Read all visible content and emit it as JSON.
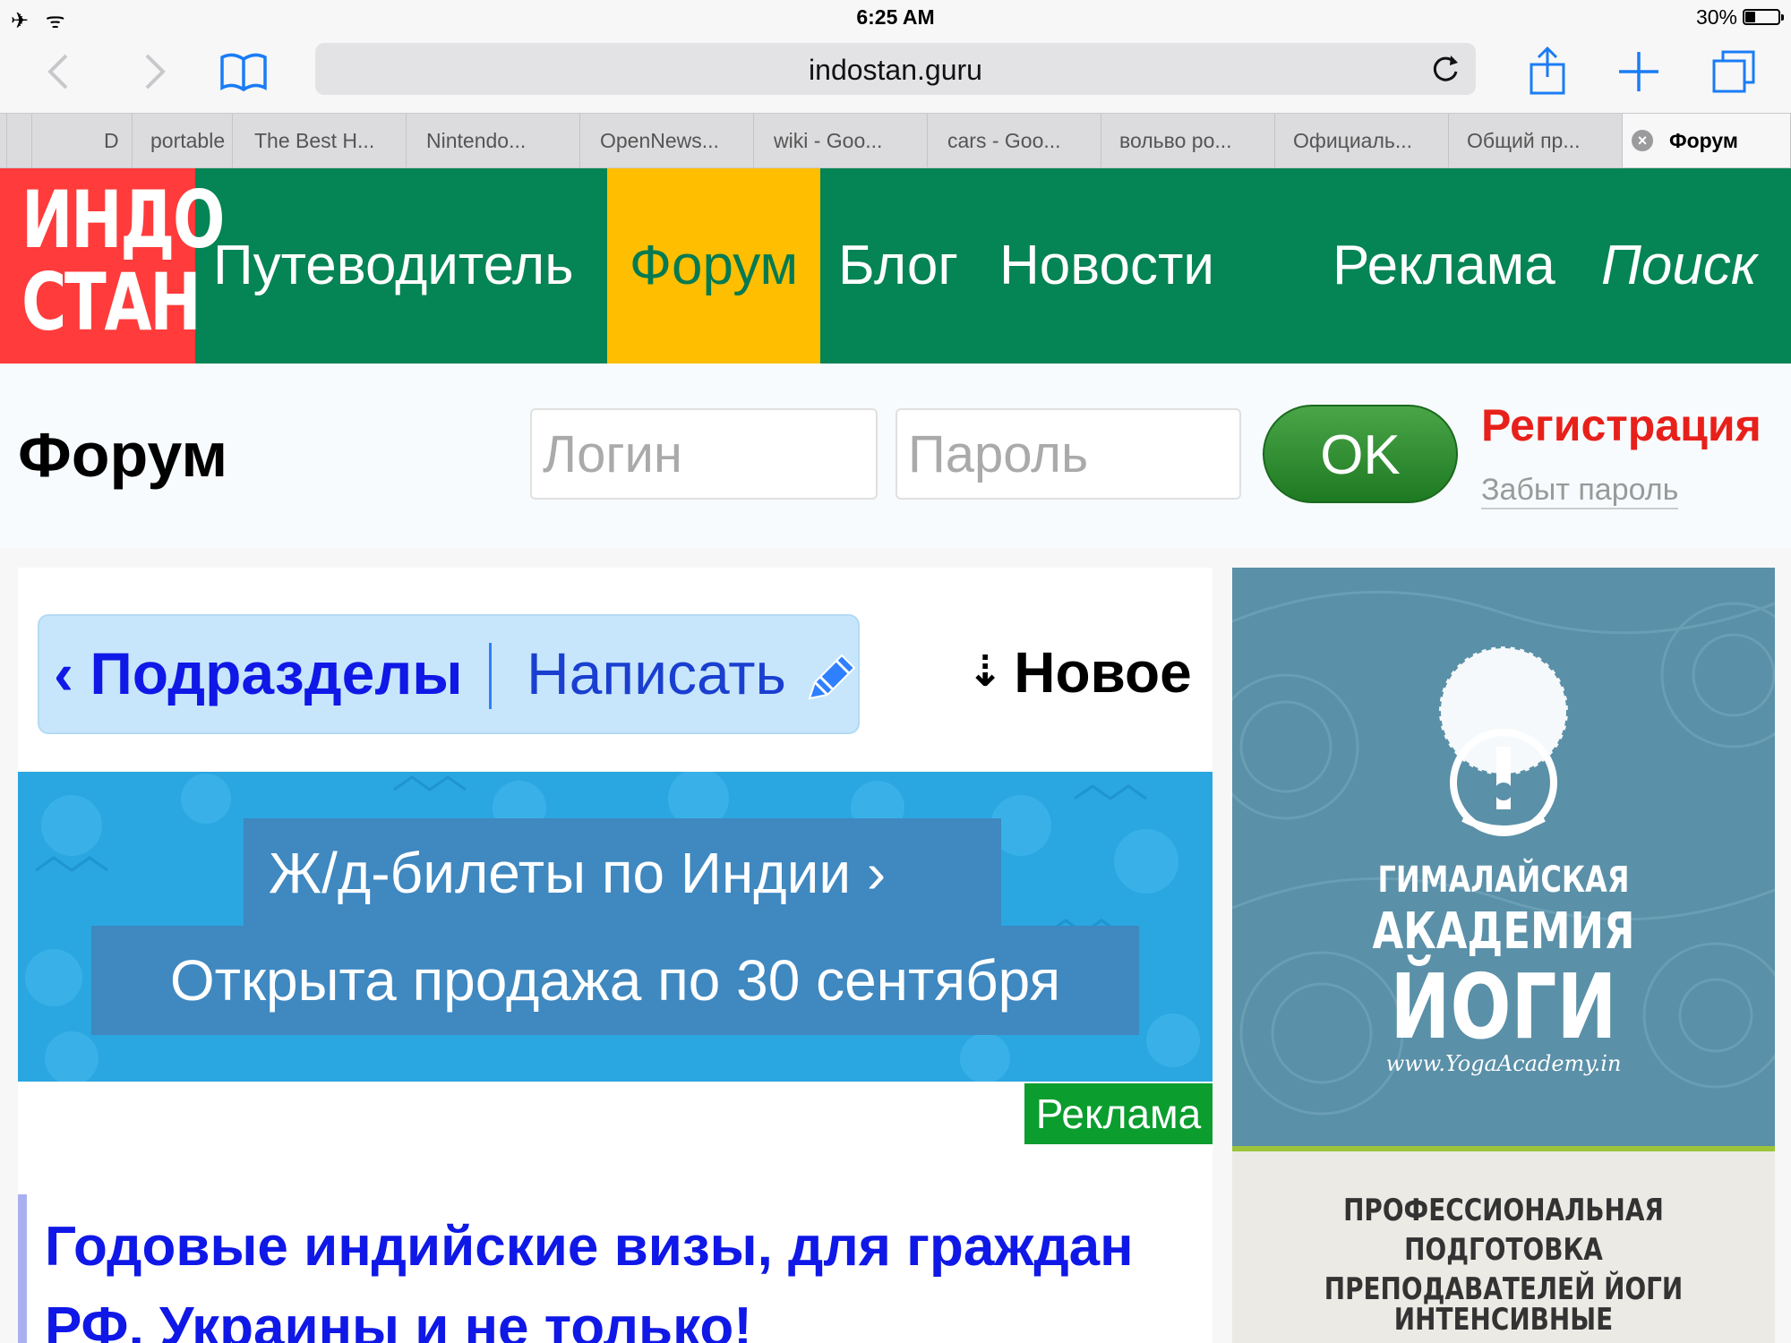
{
  "status_bar": {
    "left_icons": "✈ ᯤ",
    "time": "6:25 AM",
    "battery_text": "30%",
    "battery_level": 0.3
  },
  "toolbar": {
    "url": "indostan.guru",
    "icons": [
      "back-icon",
      "forward-icon",
      "bookmarks-icon",
      "reload-icon",
      "share-icon",
      "new-tab-icon",
      "tabs-icon"
    ]
  },
  "tabs": [
    {
      "label": ""
    },
    {
      "label": ""
    },
    {
      "label": "D"
    },
    {
      "label": "portable"
    },
    {
      "label": "The Best H..."
    },
    {
      "label": "Nintendo..."
    },
    {
      "label": "OpenNews..."
    },
    {
      "label": "wiki - Goo..."
    },
    {
      "label": "cars - Goo..."
    },
    {
      "label": "вольво ро..."
    },
    {
      "label": "Официаль..."
    },
    {
      "label": "Общий пр..."
    },
    {
      "label": "Форум",
      "active": true
    }
  ],
  "site": {
    "logo_line1": "ИНДО",
    "logo_line2": "СТАН",
    "nav": {
      "guide": "Путеводитель",
      "forum": "Форум",
      "blog": "Блог",
      "news": "Новости",
      "ads": "Реклама",
      "search": "Поиск"
    },
    "colors": {
      "nav_bg": "#058455",
      "nav_active": "#ffbe00",
      "logo_bg": "#ff3b3b",
      "link_blue": "#0f18e6",
      "register_red": "#e8201b"
    }
  },
  "login": {
    "page_title": "Форум",
    "login_placeholder": "Логин",
    "password_placeholder": "Пароль",
    "ok_label": "OK",
    "register_label": "Регистрация",
    "forgot_label": "Забыт пароль"
  },
  "forum_toolbar": {
    "subsections_label": "‹ Подразделы",
    "write_label": "Написать",
    "new_label": "Новое"
  },
  "banner": {
    "line1": "Ж/д-билеты по Индии  ›",
    "line2": "Открыта продажа по 30 сентября",
    "ad_label": "Реклама"
  },
  "article": {
    "title": "Годовые индийские визы, для граждан РФ, Украины и не только!"
  },
  "side_ad": {
    "line1": "ГИМАЛАЙСКАЯ",
    "line2": "АКАДЕМИЯ",
    "line3": "ЙОГИ",
    "site": "www.YogaAcademy.in",
    "bottom_text": "ПРОФЕССИОНАЛЬНАЯ ПОДГОТОВКА ПРЕПОДАВАТЕЛЕЙ ЙОГИ",
    "bottom_text2": "ИНТЕНСИВНЫЕ"
  }
}
